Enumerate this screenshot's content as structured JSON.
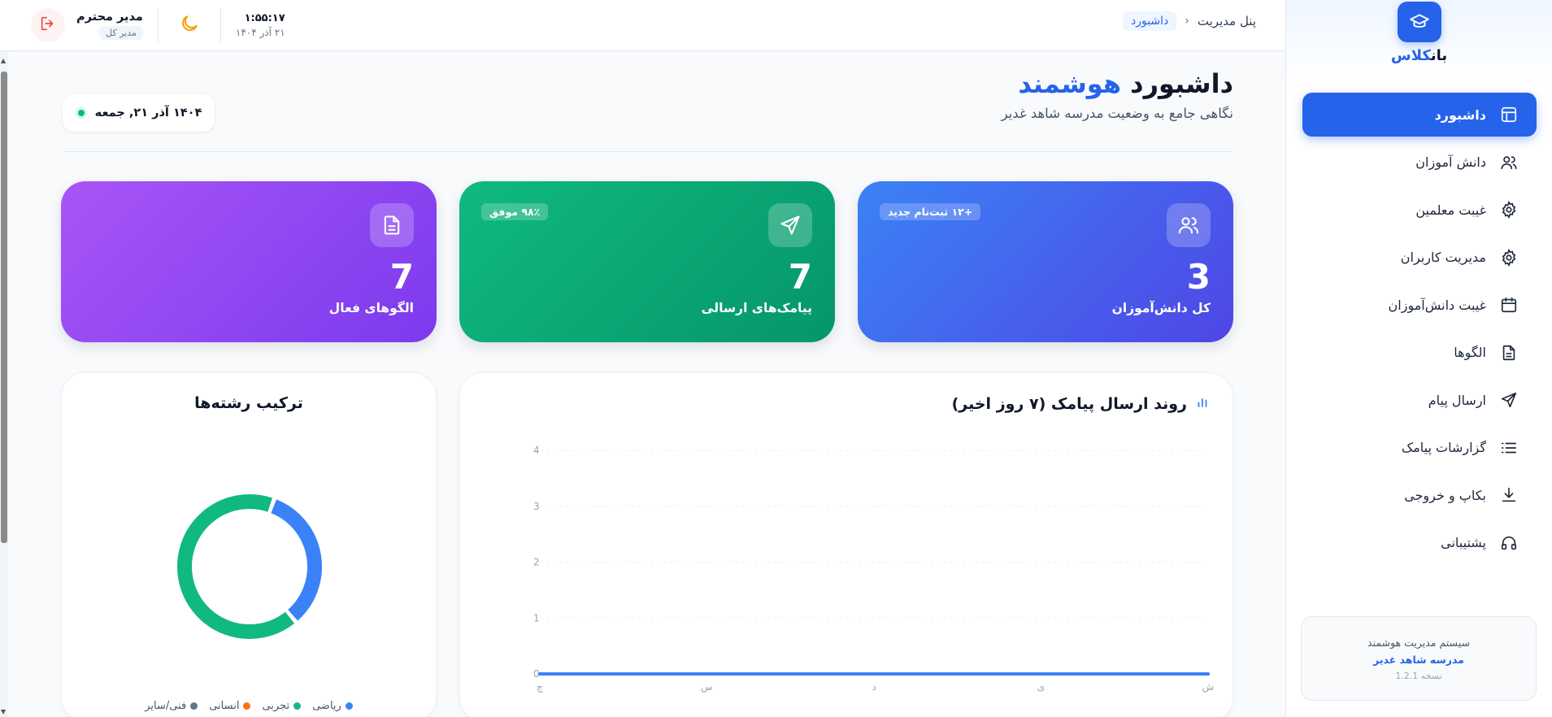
{
  "brand": {
    "name_part_a": "کلاس",
    "name_part_b": "بان"
  },
  "sidebar": {
    "items": [
      {
        "label": "داشبورد",
        "icon": "layout-icon",
        "active": true
      },
      {
        "label": "دانش آموزان",
        "icon": "users-icon"
      },
      {
        "label": "غیبت معلمین",
        "icon": "gear-icon"
      },
      {
        "label": "مدیریت کاربران",
        "icon": "gear-icon"
      },
      {
        "label": "غیبت دانش‌آموزان",
        "icon": "calendar-icon"
      },
      {
        "label": "الگوها",
        "icon": "document-icon"
      },
      {
        "label": "ارسال پیام",
        "icon": "send-icon"
      },
      {
        "label": "گزارشات پیامک",
        "icon": "list-icon"
      },
      {
        "label": "بکاپ و خروجی",
        "icon": "download-icon"
      },
      {
        "label": "پشتیبانی",
        "icon": "headphones-icon"
      }
    ],
    "footer": {
      "system": "سیستم مدیریت هوشمند",
      "school": "مدرسه شاهد غدیر",
      "version": "نسخه 1.2.1"
    }
  },
  "topbar": {
    "breadcrumb_root": "پنل مدیریت",
    "breadcrumb_current": "داشبورد",
    "user_name": "مدیر محترم",
    "user_role": "مدیر کل",
    "time": "۱:۵۵:۱۷",
    "date": "۲۱ آذر ۱۴۰۴"
  },
  "header": {
    "title_a": "داشبورد",
    "title_b": "هوشمند",
    "subtitle": "نگاهی جامع به وضعیت مدرسه شاهد غدیر",
    "date_pill": "۱۴۰۴ آذر ۲۱, جمعه"
  },
  "stats": {
    "students": {
      "value": "3",
      "label": "کل دانش‌آموزان",
      "badge": "+۱۲ ثبت‌نام جدید"
    },
    "sms": {
      "value": "7",
      "label": "پیامک‌های ارسالی",
      "badge": "۹۸٪ موفق"
    },
    "templates": {
      "value": "7",
      "label": "الگوهای فعال"
    }
  },
  "colors": {
    "accent": "#2563eb",
    "blue": "#3b82f6",
    "green": "#10b981",
    "orange": "#f97316",
    "gray": "#64748b"
  },
  "chart_data": [
    {
      "type": "line",
      "title": "روند ارسال پیامک (۷ روز اخیر)",
      "x": [
        "ش",
        "ی",
        "د",
        "س",
        "چ"
      ],
      "series": [
        {
          "values": [
            0,
            0,
            0,
            0,
            0
          ]
        }
      ],
      "ylim": [
        0,
        4
      ],
      "yticks": [
        "0",
        "1",
        "2",
        "3",
        "4"
      ],
      "grid": true
    },
    {
      "type": "pie",
      "title": "ترکیب رشته‌ها",
      "donut": true,
      "categories": [
        "ریاضی",
        "تجربی",
        "انسانی",
        "فنی/سایر"
      ],
      "values": [
        1,
        2,
        0,
        0
      ],
      "legend": "bottom"
    }
  ]
}
